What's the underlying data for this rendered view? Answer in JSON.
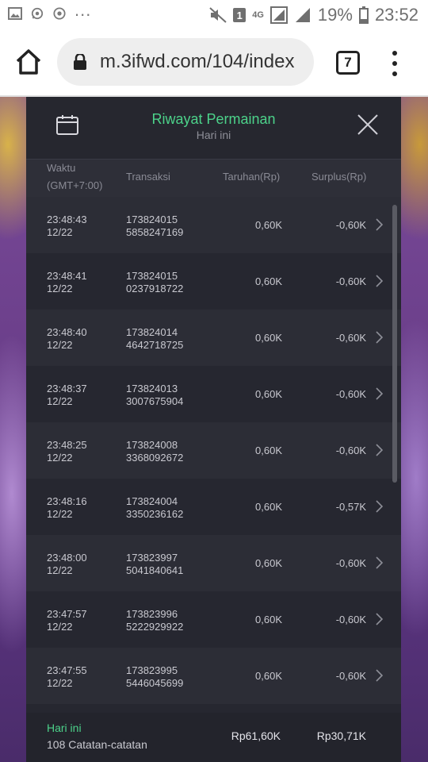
{
  "statusbar": {
    "dots": "...",
    "notification_count": "1",
    "network_type": "4G",
    "battery_percent": "19%",
    "time": "23:52"
  },
  "browser": {
    "url": "m.3ifwd.com/104/index",
    "tab_count": "7"
  },
  "modal": {
    "title": "Riwayat Permainan",
    "subtitle": "Hari ini",
    "columns": {
      "time": "Waktu",
      "time_zone": "(GMT+7:00)",
      "transaction": "Transaksi",
      "bet": "Taruhan(Rp)",
      "surplus": "Surplus(Rp)"
    },
    "rows": [
      {
        "time": "23:48:43",
        "date": "12/22",
        "tx1": "173824015",
        "tx2": "5858247169",
        "bet": "0,60K",
        "surplus": "-0,60K"
      },
      {
        "time": "23:48:41",
        "date": "12/22",
        "tx1": "173824015",
        "tx2": "0237918722",
        "bet": "0,60K",
        "surplus": "-0,60K"
      },
      {
        "time": "23:48:40",
        "date": "12/22",
        "tx1": "173824014",
        "tx2": "4642718725",
        "bet": "0,60K",
        "surplus": "-0,60K"
      },
      {
        "time": "23:48:37",
        "date": "12/22",
        "tx1": "173824013",
        "tx2": "3007675904",
        "bet": "0,60K",
        "surplus": "-0,60K"
      },
      {
        "time": "23:48:25",
        "date": "12/22",
        "tx1": "173824008",
        "tx2": "3368092672",
        "bet": "0,60K",
        "surplus": "-0,60K"
      },
      {
        "time": "23:48:16",
        "date": "12/22",
        "tx1": "173824004",
        "tx2": "3350236162",
        "bet": "0,60K",
        "surplus": "-0,57K"
      },
      {
        "time": "23:48:00",
        "date": "12/22",
        "tx1": "173823997",
        "tx2": "5041840641",
        "bet": "0,60K",
        "surplus": "-0,60K"
      },
      {
        "time": "23:47:57",
        "date": "12/22",
        "tx1": "173823996",
        "tx2": "5222929922",
        "bet": "0,60K",
        "surplus": "-0,60K"
      },
      {
        "time": "23:47:55",
        "date": "12/22",
        "tx1": "173823995",
        "tx2": "5446045699",
        "bet": "0,60K",
        "surplus": "-0,60K"
      }
    ],
    "footer": {
      "label": "Hari ini",
      "count": "108 Catatan-catatan",
      "total_bet": "Rp61,60K",
      "total_surplus": "Rp30,71K"
    }
  },
  "colors": {
    "accent_green": "#4cd28a",
    "modal_bg": "#2a2b34"
  },
  "icons": [
    "image-icon",
    "whatsapp-icon",
    "chrome-icon",
    "mute-icon",
    "signal-icon",
    "battery-icon",
    "home-icon",
    "lock-icon",
    "tab-switcher-icon",
    "more-menu-icon",
    "calendar-icon",
    "close-icon",
    "chevron-right-icon"
  ]
}
